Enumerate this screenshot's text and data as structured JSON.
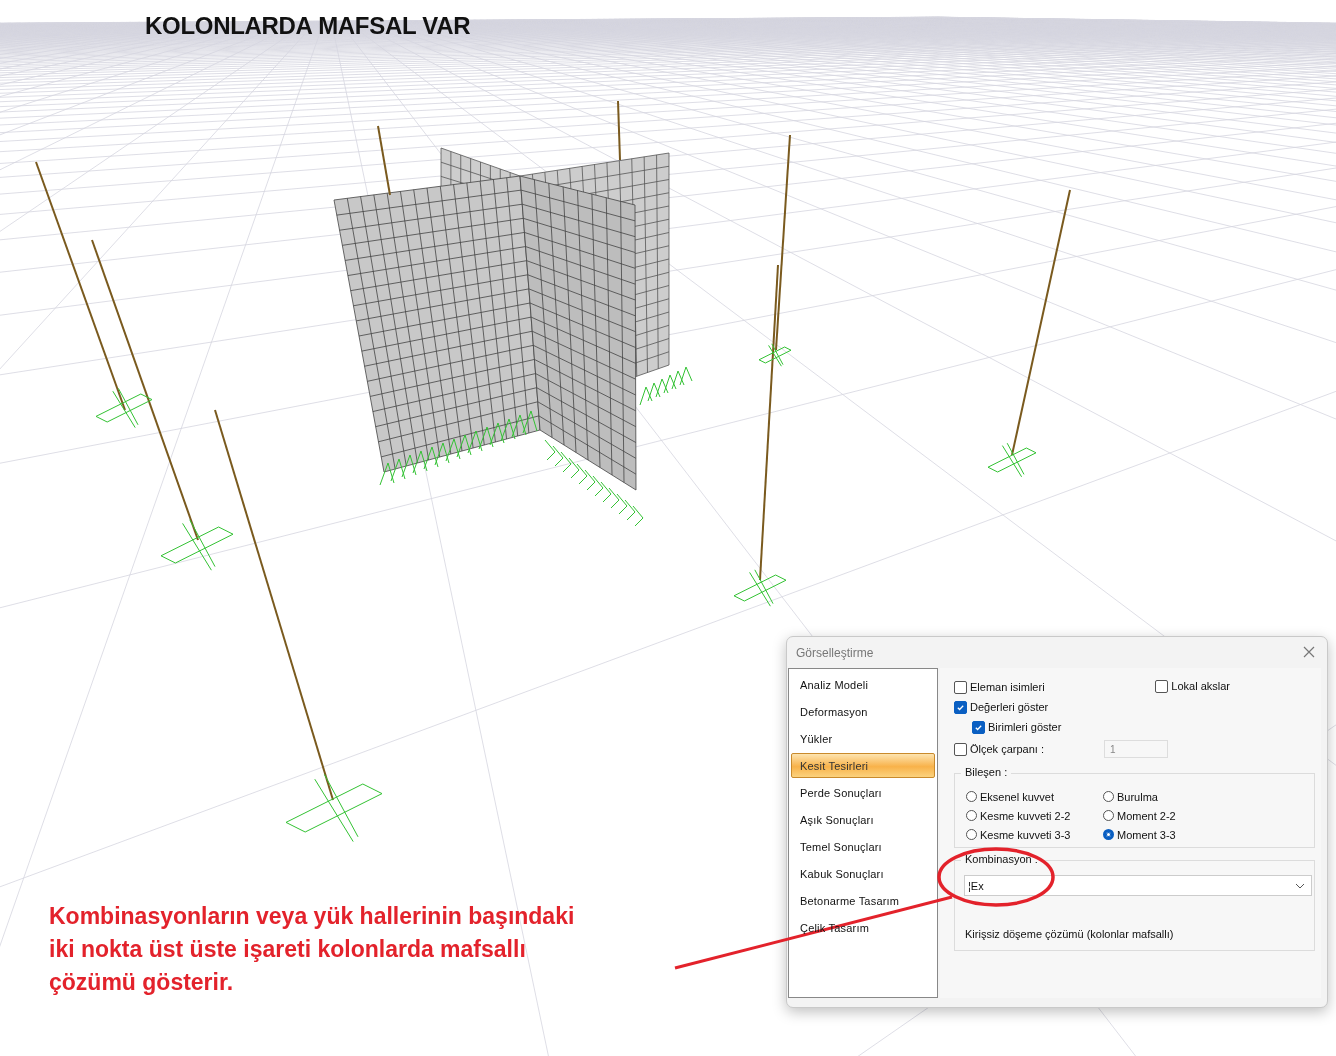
{
  "title": "KOLONLARDA MAFSAL VAR",
  "annotation": [
    "Kombinasyonların veya yük hallerinin başındaki",
    "iki nokta üst üste işareti kolonlarda mafsallı",
    "çözümü gösterir."
  ],
  "dialog": {
    "title": "Görselleştirme",
    "menu": [
      {
        "label": "Analiz Modeli",
        "selected": false
      },
      {
        "label": "Deformasyon",
        "selected": false
      },
      {
        "label": "Yükler",
        "selected": false
      },
      {
        "label": "Kesit Tesirleri",
        "selected": true
      },
      {
        "label": "Perde Sonuçları",
        "selected": false
      },
      {
        "label": "Aşık Sonuçları",
        "selected": false
      },
      {
        "label": "Temel Sonuçları",
        "selected": false
      },
      {
        "label": "Kabuk Sonuçları",
        "selected": false
      },
      {
        "label": "Betonarme Tasarım",
        "selected": false
      },
      {
        "label": "Çelik Tasarım",
        "selected": false
      }
    ],
    "element_names": {
      "label": "Eleman isimleri",
      "checked": false
    },
    "local_axes": {
      "label": "Lokal akslar",
      "checked": false
    },
    "show_values": {
      "label": "Değerleri göster",
      "checked": true
    },
    "show_units": {
      "label": "Birimleri göster",
      "checked": true
    },
    "scale_factor": {
      "label": "Ölçek çarpanı :",
      "checked": false,
      "value": "1"
    },
    "component": {
      "label": "Bileşen :",
      "options": [
        {
          "label": "Eksenel kuvvet",
          "selected": false
        },
        {
          "label": "Burulma",
          "selected": false
        },
        {
          "label": "Kesme kuvveti 2-2",
          "selected": false
        },
        {
          "label": "Moment 2-2",
          "selected": false
        },
        {
          "label": "Kesme kuvveti 3-3",
          "selected": false
        },
        {
          "label": "Moment 3-3",
          "selected": true
        }
      ]
    },
    "combination": {
      "label": "Kombinasyon :",
      "value": "¦Ex",
      "note": "Kirişsiz döşeme çözümü (kolonlar mafsallı)"
    }
  }
}
